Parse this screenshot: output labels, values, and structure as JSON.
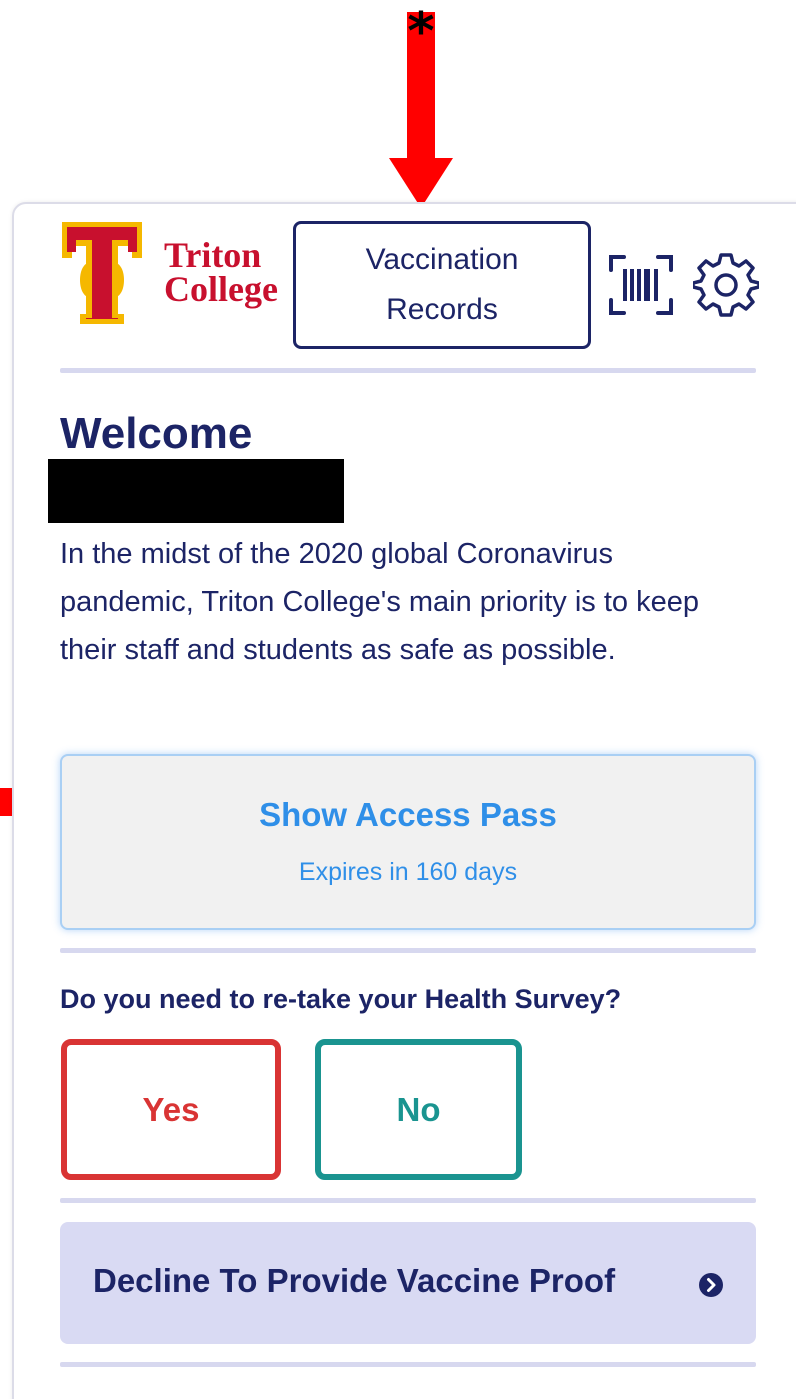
{
  "header": {
    "logo": {
      "line1": "Triton",
      "line2": "College",
      "icon": "triton-tc-logo-icon"
    },
    "vaccination_button": {
      "line1": "Vaccination",
      "line2": "Records"
    },
    "icons": [
      "barcode-scan-icon",
      "gear-icon"
    ]
  },
  "annotations": {
    "asterisk": "*",
    "arrow_color": "#ff0000"
  },
  "welcome": {
    "title": "Welcome",
    "intro": "In the midst of the 2020 global Coronavirus pandemic, Triton College's main priority is to keep their staff and students as safe as possible."
  },
  "access_pass": {
    "title": "Show Access Pass",
    "subtitle": "Expires in 160 days"
  },
  "survey": {
    "question": "Do you need to re-take your Health Survey?",
    "yes_label": "Yes",
    "no_label": "No"
  },
  "decline": {
    "label": "Decline To Provide Vaccine Proof",
    "icon": "chevron-right-circle-icon"
  },
  "colors": {
    "navy": "#1c2466",
    "brand_red": "#c8102e",
    "brand_gold": "#f5b800",
    "access_blue": "#2f8fe8",
    "yes_red": "#d93434",
    "no_teal": "#1a9490",
    "divider": "#d7d8ef",
    "decline_bg": "#d9daf3"
  }
}
